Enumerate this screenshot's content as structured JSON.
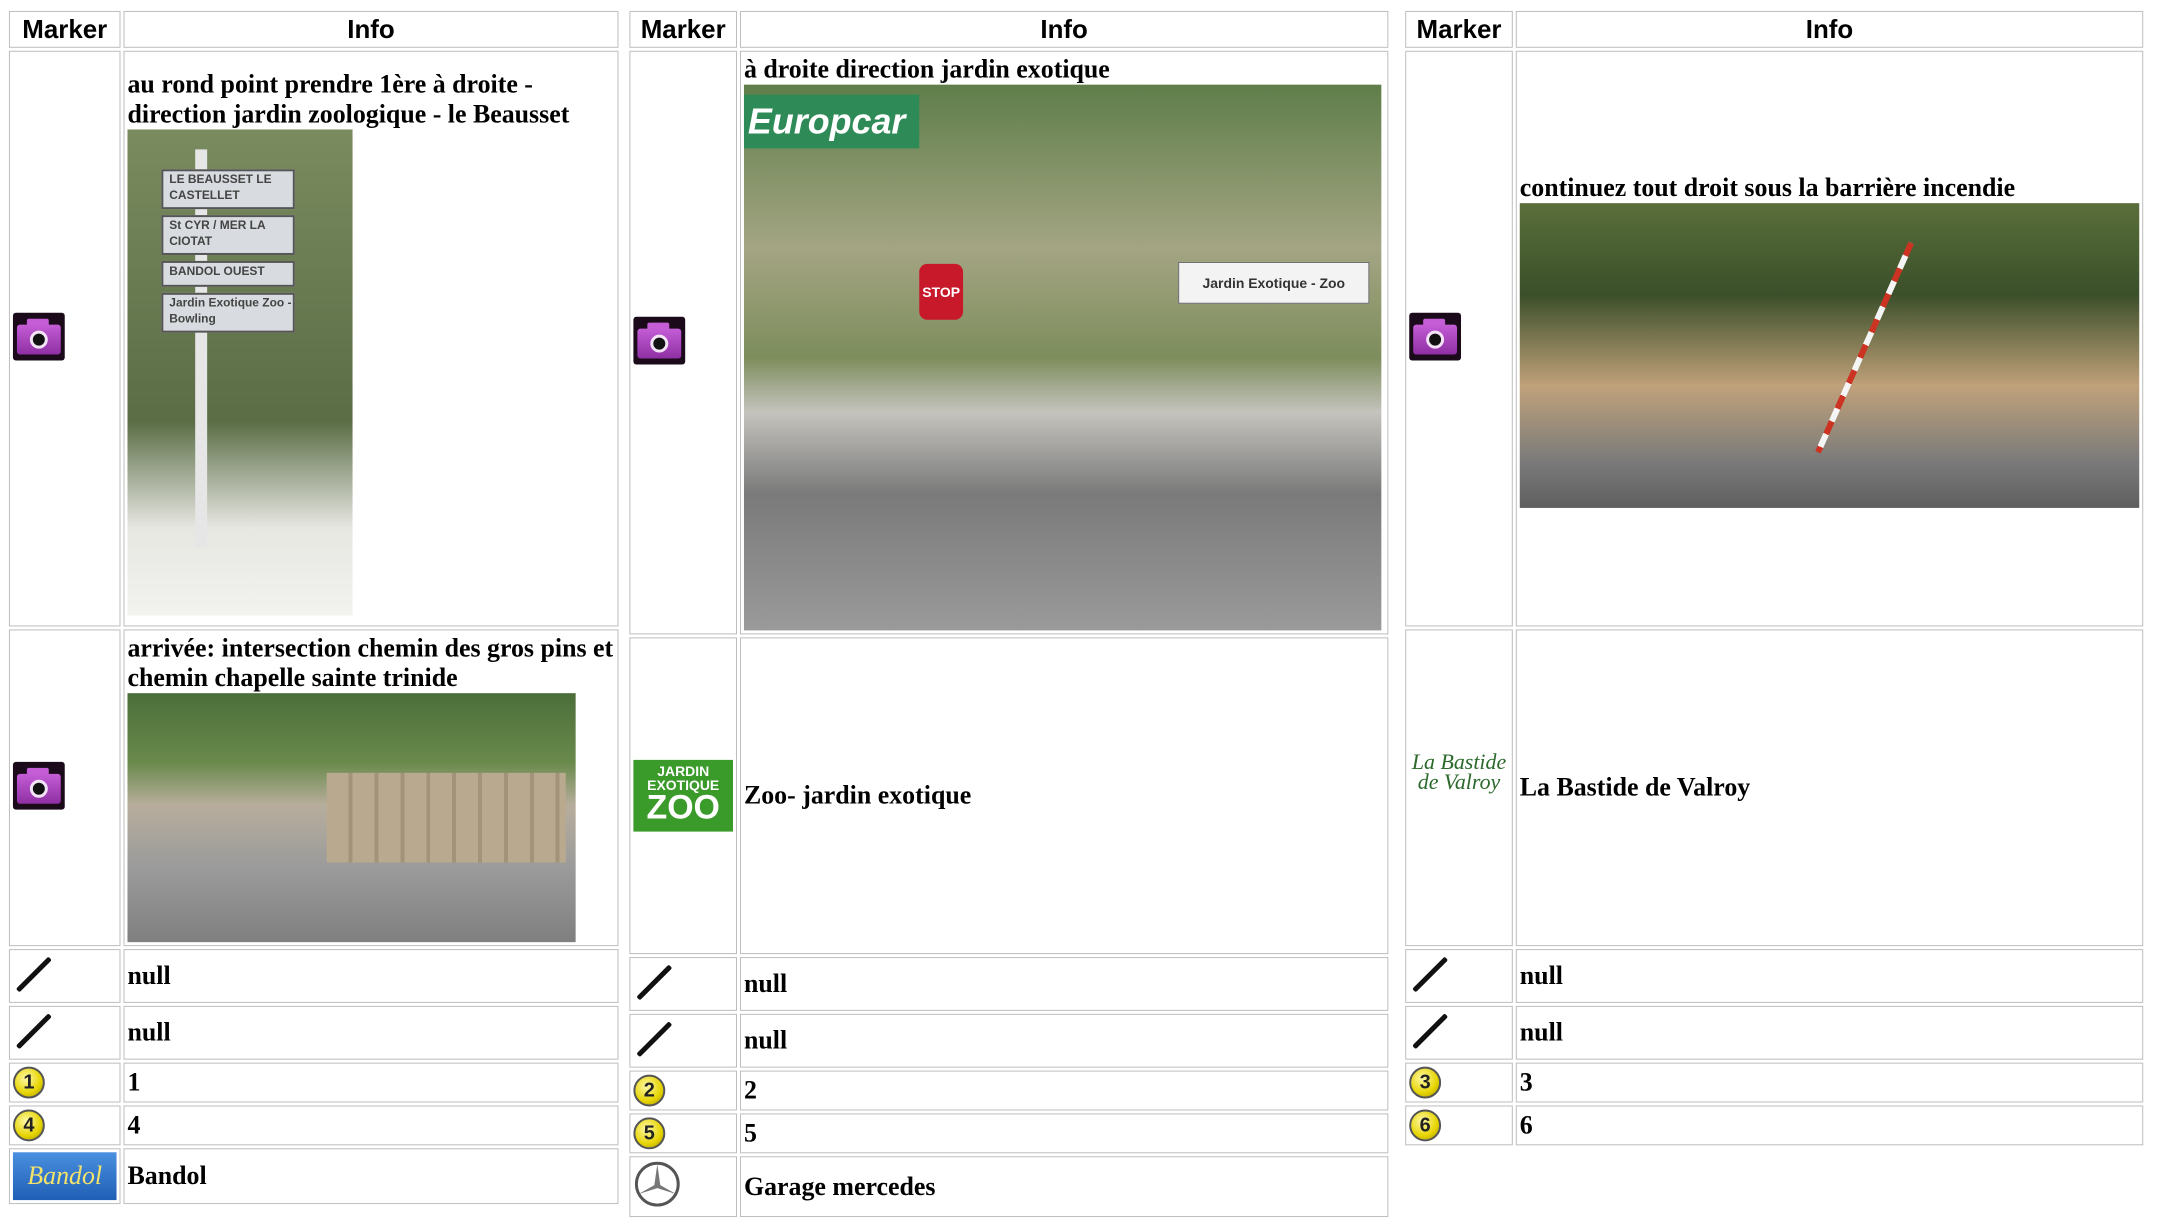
{
  "headers": {
    "marker": "Marker",
    "info": "Info"
  },
  "columns": [
    {
      "rows": [
        {
          "marker": "camera-icon",
          "text": "au rond point prendre 1ère à droite - direction jardin zoologique - le Beausset",
          "photo": "photo-road-signs",
          "signs": [
            "LE BEAUSSET\nLE CASTELLET",
            "St CYR / MER\nLA CIOTAT",
            "BANDOL OUEST",
            "Jardin Exotique\nZoo - Bowling"
          ]
        },
        {
          "marker": "camera-icon",
          "text": "arrivée: intersection chemin des gros pins et chemin chapelle sainte trinide",
          "photo": "photo-intersection"
        },
        {
          "marker": "line-icon",
          "text": "null"
        },
        {
          "marker": "line-icon",
          "text": "null"
        },
        {
          "marker": "number-icon",
          "num": "1",
          "text": "1"
        },
        {
          "marker": "number-icon",
          "num": "4",
          "text": "4"
        },
        {
          "marker": "bandol-logo",
          "logo_text": "Bandol",
          "text": "Bandol"
        }
      ]
    },
    {
      "rows": [
        {
          "marker": "camera-icon",
          "text": "à droite direction jardin exotique",
          "photo": "photo-junction",
          "europcar": "Europcar",
          "stop": "STOP",
          "jardin_sign": "Jardin Exotique - Zoo"
        },
        {
          "marker": "zoo-logo",
          "logo_a": "JARDIN EXOTIQUE",
          "logo_b": "ZOO",
          "text": "Zoo- jardin exotique"
        },
        {
          "marker": "line-icon",
          "text": "null"
        },
        {
          "marker": "line-icon",
          "text": "null"
        },
        {
          "marker": "number-icon",
          "num": "2",
          "text": "2"
        },
        {
          "marker": "number-icon",
          "num": "5",
          "text": "5"
        },
        {
          "marker": "mercedes-logo",
          "text": "Garage mercedes"
        }
      ]
    },
    {
      "rows": [
        {
          "marker": "camera-icon",
          "text": "continuez tout droit sous la barrière incendie",
          "photo": "photo-barrier"
        },
        {
          "marker": "bastide-logo",
          "logo_text": "La Bastide de Valroy",
          "text": "La Bastide de Valroy"
        },
        {
          "marker": "line-icon",
          "text": "null"
        },
        {
          "marker": "line-icon",
          "text": "null"
        },
        {
          "marker": "number-icon",
          "num": "3",
          "text": "3"
        },
        {
          "marker": "number-icon",
          "num": "6",
          "text": "6"
        }
      ]
    }
  ]
}
